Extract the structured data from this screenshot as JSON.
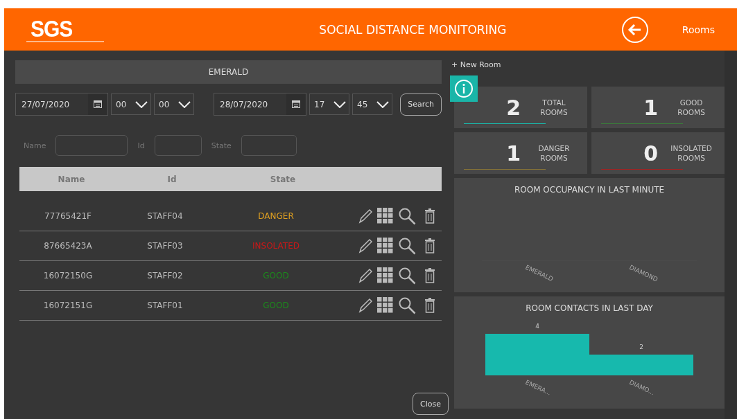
{
  "header": {
    "logo": "SGS",
    "title": "SOCIAL DISTANCE MONITORING",
    "nav_link": "Rooms"
  },
  "room": {
    "name": "EMERALD",
    "date_from": {
      "date": "27/07/2020",
      "hour": "00",
      "minute": "00"
    },
    "date_to": {
      "date": "28/07/2020",
      "hour": "17",
      "minute": "45"
    },
    "search_button": "Search",
    "filters": [
      {
        "label": "Name"
      },
      {
        "label": "Id"
      },
      {
        "label": "State"
      }
    ],
    "table": {
      "columns": [
        "Name",
        "Id",
        "State"
      ],
      "rows": [
        {
          "name": "77765421F",
          "id": "STAFF04",
          "state": "DANGER",
          "color": "#e0a020"
        },
        {
          "name": "87665423A",
          "id": "STAFF03",
          "state": "INSOLATED",
          "color": "#c81818"
        },
        {
          "name": "16072150G",
          "id": "STAFF02",
          "state": "GOOD",
          "color": "#1c8a1c"
        },
        {
          "name": "16072151G",
          "id": "STAFF01",
          "state": "GOOD",
          "color": "#1c8a1c"
        }
      ]
    },
    "close_button": "Close"
  },
  "sidebar": {
    "new_room": "+  New Room",
    "stats": [
      {
        "value": "2",
        "label": "TOTAL ROOMS",
        "color": "#1ab5a8"
      },
      {
        "value": "1",
        "label": "GOOD ROOMS",
        "color": "#3a7a3a"
      },
      {
        "value": "1",
        "label": "DANGER ROOMS",
        "color": "#8a7636"
      },
      {
        "value": "0",
        "label": "INSOLATED ROOMS",
        "color": "#a82020"
      }
    ],
    "charts": [
      {
        "title": "ROOM OCCUPANCY IN LAST MINUTE",
        "axis_labels": [
          "EMERALD",
          "DIAMOND"
        ]
      },
      {
        "title": "ROOM CONTACTS IN LAST DAY",
        "chart_data": {
          "type": "bar",
          "categories": [
            "EMERA...",
            "DIAMO..."
          ],
          "values": [
            4,
            2
          ],
          "data_labels": true
        }
      }
    ]
  }
}
